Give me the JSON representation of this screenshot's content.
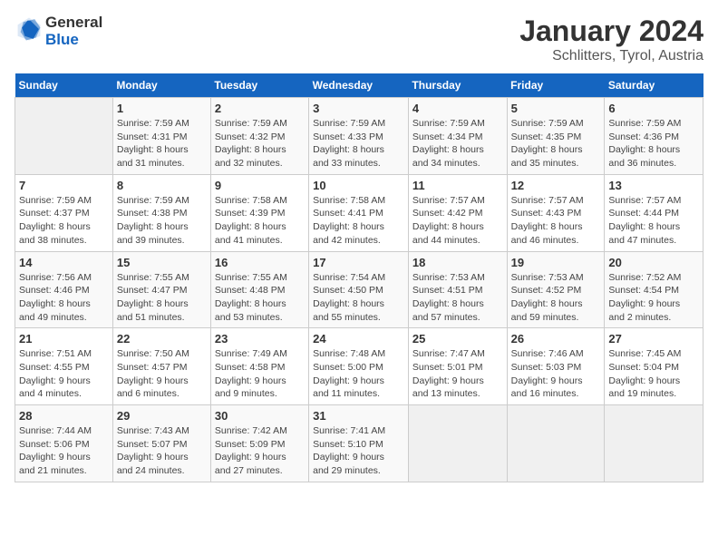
{
  "logo": {
    "general": "General",
    "blue": "Blue"
  },
  "title": "January 2024",
  "subtitle": "Schlitters, Tyrol, Austria",
  "days_header": [
    "Sunday",
    "Monday",
    "Tuesday",
    "Wednesday",
    "Thursday",
    "Friday",
    "Saturday"
  ],
  "weeks": [
    [
      {
        "num": "",
        "info": ""
      },
      {
        "num": "1",
        "info": "Sunrise: 7:59 AM\nSunset: 4:31 PM\nDaylight: 8 hours\nand 31 minutes."
      },
      {
        "num": "2",
        "info": "Sunrise: 7:59 AM\nSunset: 4:32 PM\nDaylight: 8 hours\nand 32 minutes."
      },
      {
        "num": "3",
        "info": "Sunrise: 7:59 AM\nSunset: 4:33 PM\nDaylight: 8 hours\nand 33 minutes."
      },
      {
        "num": "4",
        "info": "Sunrise: 7:59 AM\nSunset: 4:34 PM\nDaylight: 8 hours\nand 34 minutes."
      },
      {
        "num": "5",
        "info": "Sunrise: 7:59 AM\nSunset: 4:35 PM\nDaylight: 8 hours\nand 35 minutes."
      },
      {
        "num": "6",
        "info": "Sunrise: 7:59 AM\nSunset: 4:36 PM\nDaylight: 8 hours\nand 36 minutes."
      }
    ],
    [
      {
        "num": "7",
        "info": "Sunrise: 7:59 AM\nSunset: 4:37 PM\nDaylight: 8 hours\nand 38 minutes."
      },
      {
        "num": "8",
        "info": "Sunrise: 7:59 AM\nSunset: 4:38 PM\nDaylight: 8 hours\nand 39 minutes."
      },
      {
        "num": "9",
        "info": "Sunrise: 7:58 AM\nSunset: 4:39 PM\nDaylight: 8 hours\nand 41 minutes."
      },
      {
        "num": "10",
        "info": "Sunrise: 7:58 AM\nSunset: 4:41 PM\nDaylight: 8 hours\nand 42 minutes."
      },
      {
        "num": "11",
        "info": "Sunrise: 7:57 AM\nSunset: 4:42 PM\nDaylight: 8 hours\nand 44 minutes."
      },
      {
        "num": "12",
        "info": "Sunrise: 7:57 AM\nSunset: 4:43 PM\nDaylight: 8 hours\nand 46 minutes."
      },
      {
        "num": "13",
        "info": "Sunrise: 7:57 AM\nSunset: 4:44 PM\nDaylight: 8 hours\nand 47 minutes."
      }
    ],
    [
      {
        "num": "14",
        "info": "Sunrise: 7:56 AM\nSunset: 4:46 PM\nDaylight: 8 hours\nand 49 minutes."
      },
      {
        "num": "15",
        "info": "Sunrise: 7:55 AM\nSunset: 4:47 PM\nDaylight: 8 hours\nand 51 minutes."
      },
      {
        "num": "16",
        "info": "Sunrise: 7:55 AM\nSunset: 4:48 PM\nDaylight: 8 hours\nand 53 minutes."
      },
      {
        "num": "17",
        "info": "Sunrise: 7:54 AM\nSunset: 4:50 PM\nDaylight: 8 hours\nand 55 minutes."
      },
      {
        "num": "18",
        "info": "Sunrise: 7:53 AM\nSunset: 4:51 PM\nDaylight: 8 hours\nand 57 minutes."
      },
      {
        "num": "19",
        "info": "Sunrise: 7:53 AM\nSunset: 4:52 PM\nDaylight: 8 hours\nand 59 minutes."
      },
      {
        "num": "20",
        "info": "Sunrise: 7:52 AM\nSunset: 4:54 PM\nDaylight: 9 hours\nand 2 minutes."
      }
    ],
    [
      {
        "num": "21",
        "info": "Sunrise: 7:51 AM\nSunset: 4:55 PM\nDaylight: 9 hours\nand 4 minutes."
      },
      {
        "num": "22",
        "info": "Sunrise: 7:50 AM\nSunset: 4:57 PM\nDaylight: 9 hours\nand 6 minutes."
      },
      {
        "num": "23",
        "info": "Sunrise: 7:49 AM\nSunset: 4:58 PM\nDaylight: 9 hours\nand 9 minutes."
      },
      {
        "num": "24",
        "info": "Sunrise: 7:48 AM\nSunset: 5:00 PM\nDaylight: 9 hours\nand 11 minutes."
      },
      {
        "num": "25",
        "info": "Sunrise: 7:47 AM\nSunset: 5:01 PM\nDaylight: 9 hours\nand 13 minutes."
      },
      {
        "num": "26",
        "info": "Sunrise: 7:46 AM\nSunset: 5:03 PM\nDaylight: 9 hours\nand 16 minutes."
      },
      {
        "num": "27",
        "info": "Sunrise: 7:45 AM\nSunset: 5:04 PM\nDaylight: 9 hours\nand 19 minutes."
      }
    ],
    [
      {
        "num": "28",
        "info": "Sunrise: 7:44 AM\nSunset: 5:06 PM\nDaylight: 9 hours\nand 21 minutes."
      },
      {
        "num": "29",
        "info": "Sunrise: 7:43 AM\nSunset: 5:07 PM\nDaylight: 9 hours\nand 24 minutes."
      },
      {
        "num": "30",
        "info": "Sunrise: 7:42 AM\nSunset: 5:09 PM\nDaylight: 9 hours\nand 27 minutes."
      },
      {
        "num": "31",
        "info": "Sunrise: 7:41 AM\nSunset: 5:10 PM\nDaylight: 9 hours\nand 29 minutes."
      },
      {
        "num": "",
        "info": ""
      },
      {
        "num": "",
        "info": ""
      },
      {
        "num": "",
        "info": ""
      }
    ]
  ]
}
